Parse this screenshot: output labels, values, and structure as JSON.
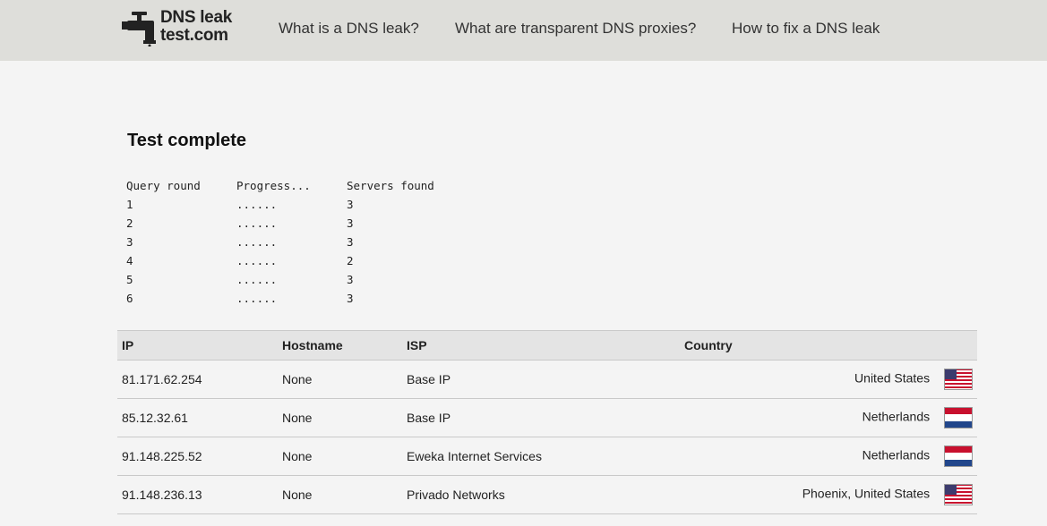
{
  "header": {
    "logo": {
      "line1": "DNS leak",
      "line2": "test.com"
    },
    "nav": [
      {
        "label": "What is a DNS leak?"
      },
      {
        "label": "What are transparent DNS proxies?"
      },
      {
        "label": "How to fix a DNS leak"
      }
    ]
  },
  "main": {
    "title": "Test complete",
    "rounds": {
      "headers": [
        "Query round",
        "Progress...",
        "Servers found"
      ],
      "rows": [
        {
          "round": "1",
          "progress": "......",
          "servers": "3"
        },
        {
          "round": "2",
          "progress": "......",
          "servers": "3"
        },
        {
          "round": "3",
          "progress": "......",
          "servers": "3"
        },
        {
          "round": "4",
          "progress": "......",
          "servers": "2"
        },
        {
          "round": "5",
          "progress": "......",
          "servers": "3"
        },
        {
          "round": "6",
          "progress": "......",
          "servers": "3"
        }
      ]
    },
    "results": {
      "headers": [
        "IP",
        "Hostname",
        "ISP",
        "Country"
      ],
      "rows": [
        {
          "ip": "81.171.62.254",
          "hostname": "None",
          "isp": "Base IP",
          "country": "United States",
          "flag": "us-flag-icon"
        },
        {
          "ip": "85.12.32.61",
          "hostname": "None",
          "isp": "Base IP",
          "country": "Netherlands",
          "flag": "nl-flag-icon"
        },
        {
          "ip": "91.148.225.52",
          "hostname": "None",
          "isp": "Eweka Internet Services",
          "country": "Netherlands",
          "flag": "nl-flag-icon"
        },
        {
          "ip": "91.148.236.13",
          "hostname": "None",
          "isp": "Privado Networks",
          "country": "Phoenix, United States",
          "flag": "us-flag-icon"
        }
      ]
    }
  },
  "colors": {
    "header_bg": "#dededa",
    "page_bg": "#f4f4f4",
    "table_header_bg": "#e4e4e4",
    "nl_red": "#c8102e",
    "nl_blue": "#21468b",
    "us_blue": "#3c3b6e"
  }
}
